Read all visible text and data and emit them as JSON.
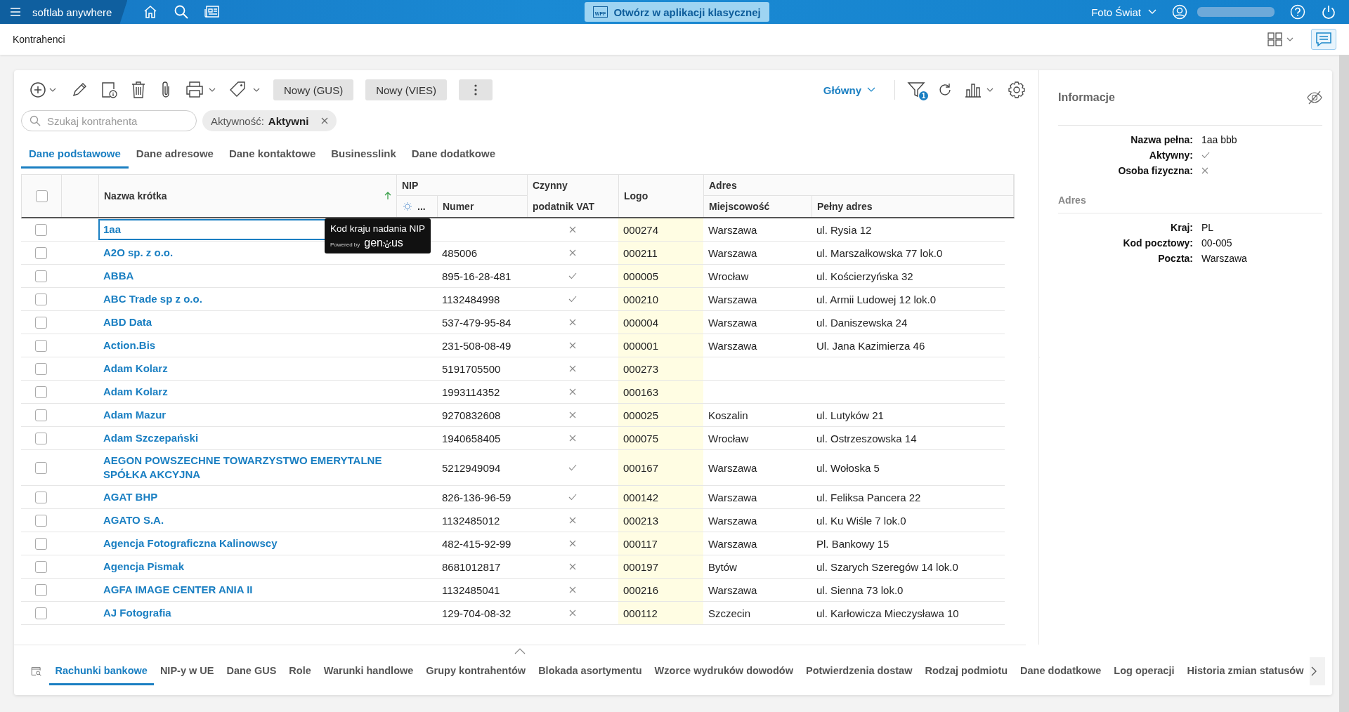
{
  "top_bar": {
    "app_name": "softlab anywhere",
    "open_classic_button": "Otwórz w aplikacji klasycznej",
    "wpf_label": "WPF",
    "company": "Foto Świat"
  },
  "page_title": "Kontrahenci",
  "toolbar": {
    "buttons": [
      "Nowy (GUS)",
      "Nowy (VIES)"
    ],
    "view": "Główny",
    "filter_badge": "1"
  },
  "search": {
    "placeholder": "Szukaj kontrahenta"
  },
  "filter_chip": {
    "label": "Aktywność:",
    "value": "Aktywni"
  },
  "tabs": [
    {
      "label": "Dane podstawowe",
      "selected": true
    },
    {
      "label": "Dane adresowe",
      "selected": false
    },
    {
      "label": "Dane kontaktowe",
      "selected": false
    },
    {
      "label": "Businesslink",
      "selected": false
    },
    {
      "label": "Dane dodatkowe",
      "selected": false
    }
  ],
  "table": {
    "header_checked": false,
    "columns": {
      "name": "Nazwa krótka",
      "nip_group": "NIP",
      "nip_flag": "...",
      "nip_number": "Numer",
      "vat": "Czynny podatnik VAT",
      "logo": "Logo",
      "address_group": "Adres",
      "city": "Miejscowość",
      "address": "Pełny adres"
    },
    "rows": [
      {
        "checked": false,
        "focused": true,
        "name": "1aa",
        "nip": "",
        "vat": false,
        "logo": "000274",
        "city": "Warszawa",
        "address": "ul. Rysia 12"
      },
      {
        "checked": false,
        "focused": false,
        "name": "A2O sp. z o.o.",
        "nip": "485006",
        "vat": false,
        "logo": "000211",
        "city": "Warszawa",
        "address": "ul. Marszałkowska 77 lok.0"
      },
      {
        "checked": false,
        "focused": false,
        "name": "ABBA",
        "nip": "895-16-28-481",
        "vat": true,
        "logo": "000005",
        "city": "Wrocław",
        "address": "ul. Kościerzyńska 32"
      },
      {
        "checked": false,
        "focused": false,
        "name": "ABC Trade sp z o.o.",
        "nip": "1132484998",
        "vat": true,
        "logo": "000210",
        "city": "Warszawa",
        "address": "ul. Armii Ludowej 12 lok.0"
      },
      {
        "checked": false,
        "focused": false,
        "name": "ABD Data",
        "nip": "537-479-95-84",
        "vat": false,
        "logo": "000004",
        "city": "Warszawa",
        "address": "ul. Daniszewska 24"
      },
      {
        "checked": false,
        "focused": false,
        "name": "Action.Bis",
        "nip": "231-508-08-49",
        "vat": false,
        "logo": "000001",
        "city": "Warszawa",
        "address": "Ul. Jana Kazimierza 46"
      },
      {
        "checked": false,
        "focused": false,
        "name": "Adam Kolarz",
        "nip": "5191705500",
        "vat": false,
        "logo": "000273",
        "city": "",
        "address": ""
      },
      {
        "checked": false,
        "focused": false,
        "name": "Adam Kolarz",
        "nip": "1993114352",
        "vat": false,
        "logo": "000163",
        "city": "",
        "address": ""
      },
      {
        "checked": false,
        "focused": false,
        "name": "Adam Mazur",
        "nip": "9270832608",
        "vat": false,
        "logo": "000025",
        "city": "Koszalin",
        "address": "ul. Lutyków 21"
      },
      {
        "checked": false,
        "focused": false,
        "name": "Adam Szczepański",
        "nip": "1940658405",
        "vat": false,
        "logo": "000075",
        "city": "Wrocław",
        "address": "ul. Ostrzeszowska 14"
      },
      {
        "checked": false,
        "focused": false,
        "name": "AEGON POWSZECHNE TOWARZYSTWO EMERYTALNE SPÓŁKA AKCYJNA",
        "nip": "5212949094",
        "vat": true,
        "logo": "000167",
        "city": "Warszawa",
        "address": "ul. Wołoska 5"
      },
      {
        "checked": false,
        "focused": false,
        "name": "AGAT BHP",
        "nip": "826-136-96-59",
        "vat": true,
        "logo": "000142",
        "city": "Warszawa",
        "address": "ul. Feliksa Pancera 22"
      },
      {
        "checked": false,
        "focused": false,
        "name": "AGATO S.A.",
        "nip": "1132485012",
        "vat": false,
        "logo": "000213",
        "city": "Warszawa",
        "address": "ul. Ku Wiśle 7 lok.0"
      },
      {
        "checked": false,
        "focused": false,
        "name": "Agencja Fotograficzna Kalinowscy",
        "nip": "482-415-92-99",
        "vat": false,
        "logo": "000117",
        "city": "Warszawa",
        "address": "Pl. Bankowy 15"
      },
      {
        "checked": false,
        "focused": false,
        "name": "Agencja Pismak",
        "nip": "8681012817",
        "vat": false,
        "logo": "000197",
        "city": "Bytów",
        "address": "ul. Szarych Szeregów 14 lok.0"
      },
      {
        "checked": false,
        "focused": false,
        "name": "AGFA IMAGE CENTER ANIA II",
        "nip": "1132485041",
        "vat": false,
        "logo": "000216",
        "city": "Warszawa",
        "address": "ul. Sienna 73 lok.0"
      },
      {
        "checked": false,
        "focused": false,
        "name": "AJ Fotografia",
        "nip": "129-704-08-32",
        "vat": false,
        "logo": "000112",
        "city": "Szczecin",
        "address": "ul. Karłowicza Mieczysława 10"
      }
    ]
  },
  "tooltip": {
    "title": "Kod kraju nadania NIP",
    "powered_by": "Powered by",
    "brand_start": "gen",
    "brand_end": "us"
  },
  "info_panel": {
    "title": "Informacje",
    "fields": [
      {
        "kind": "text",
        "label": "Nazwa pełna:",
        "value": "1aa bbb"
      },
      {
        "kind": "flag",
        "label": "Aktywny:",
        "checked": true
      },
      {
        "kind": "flag",
        "label": "Osoba fizyczna:",
        "checked": false
      }
    ],
    "address_title": "Adres",
    "address_fields": [
      {
        "kind": "text",
        "label": "Kraj:",
        "value": "PL"
      },
      {
        "kind": "text",
        "label": "Kod pocztowy:",
        "value": "00-005"
      },
      {
        "kind": "text",
        "label": "Poczta:",
        "value": "Warszawa"
      }
    ]
  },
  "bottom_tabs": [
    {
      "label": "Rachunki bankowe",
      "selected": true
    },
    {
      "label": "NIP-y w UE",
      "selected": false
    },
    {
      "label": "Dane GUS",
      "selected": false
    },
    {
      "label": "Role",
      "selected": false
    },
    {
      "label": "Warunki handlowe",
      "selected": false
    },
    {
      "label": "Grupy kontrahentów",
      "selected": false
    },
    {
      "label": "Blokada asortymentu",
      "selected": false
    },
    {
      "label": "Wzorce wydruków dowodów",
      "selected": false
    },
    {
      "label": "Potwierdzenia dostaw",
      "selected": false
    },
    {
      "label": "Rodzaj podmiotu",
      "selected": false
    },
    {
      "label": "Dane dodatkowe",
      "selected": false
    },
    {
      "label": "Log operacji",
      "selected": false
    },
    {
      "label": "Historia zmian statusów",
      "selected": false
    }
  ]
}
